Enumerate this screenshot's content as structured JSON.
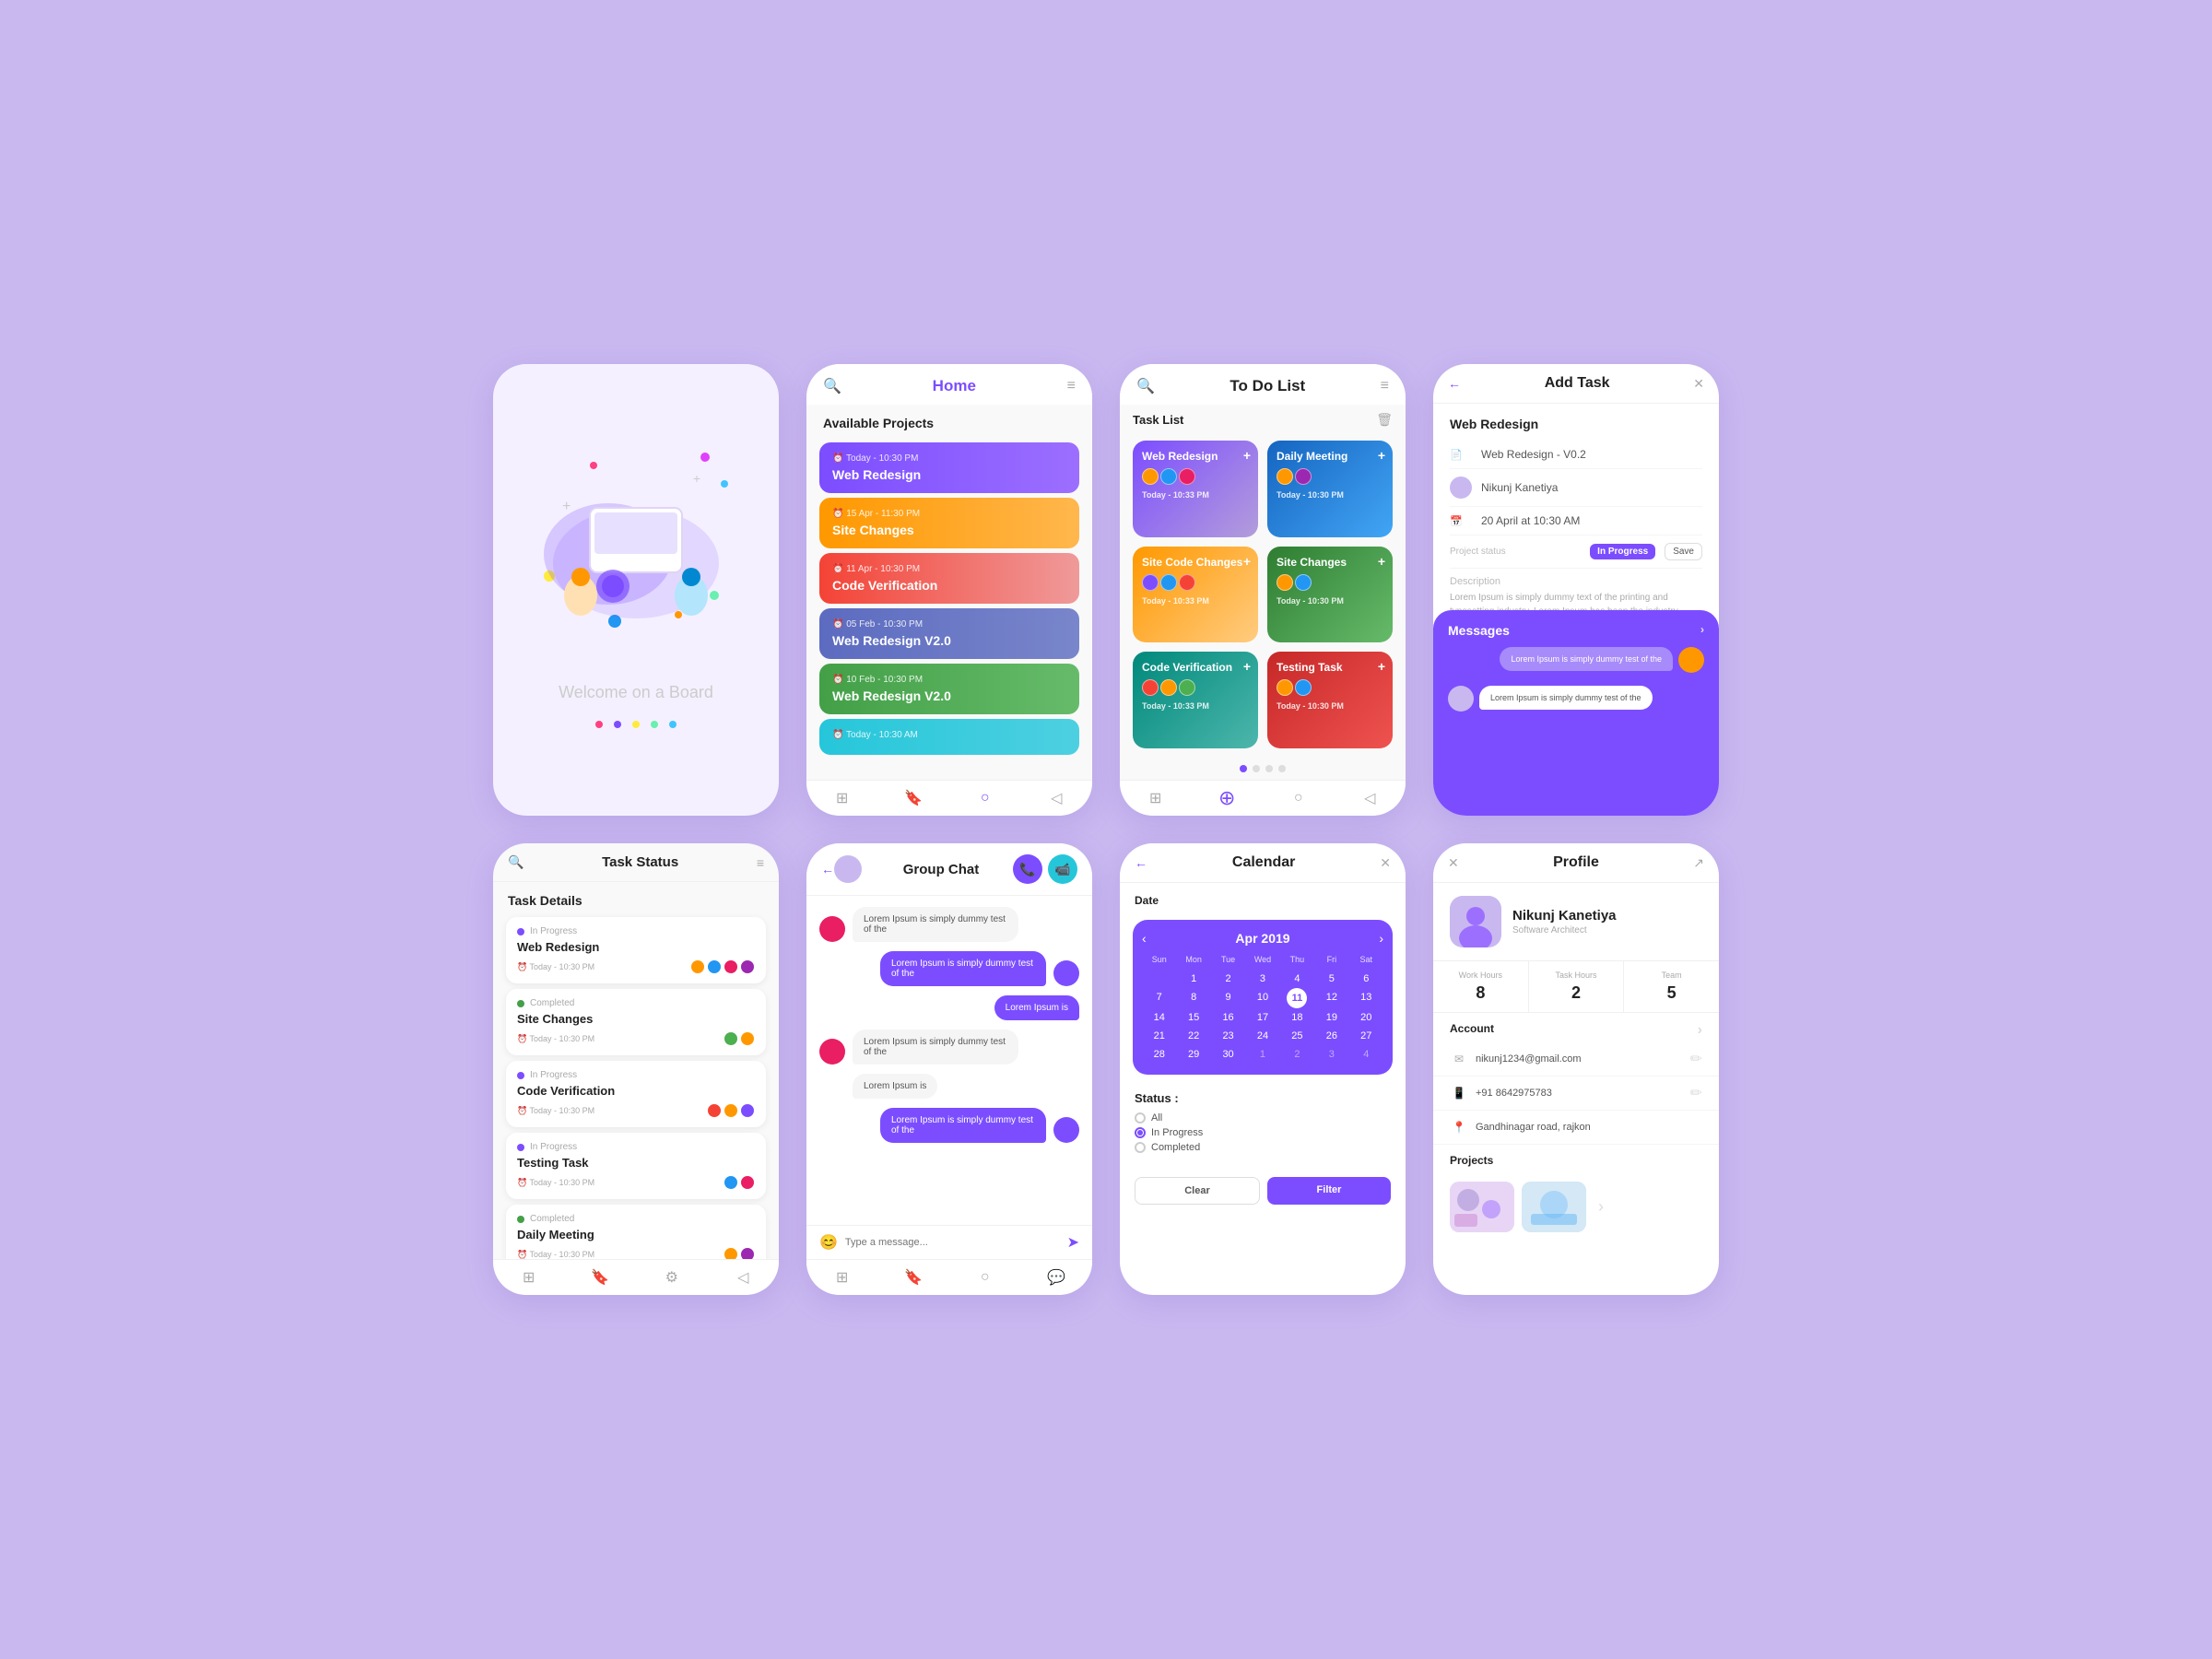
{
  "bg": "#c9b8f0",
  "screens": {
    "welcome": {
      "text": "Welcome on a Board"
    },
    "home": {
      "title": "Home",
      "section": "Available Projects",
      "projects": [
        {
          "time": "Today - 10:30 PM",
          "name": "Web Redesign",
          "color": "card-purple"
        },
        {
          "time": "15 Apr - 11:30 PM",
          "name": "Site Changes",
          "color": "card-orange"
        },
        {
          "time": "11 Apr - 10:30 PM",
          "name": "Code Verification",
          "color": "card-pink"
        },
        {
          "time": "05 Feb - 10:30 PM",
          "name": "Web Redesign V2.0",
          "color": "card-indigo"
        },
        {
          "time": "10 Feb - 10:30 PM",
          "name": "Web Redesign V2.0",
          "color": "card-green"
        },
        {
          "time": "Today - 10:30 AM",
          "name": "",
          "color": "card-teal"
        }
      ]
    },
    "todo": {
      "title": "To Do List",
      "section": "Task List",
      "tasks": [
        {
          "name": "Web Redesign",
          "color": "tc-purple",
          "time": "Today - 10:33 PM"
        },
        {
          "name": "Daily Meeting",
          "color": "tc-blue",
          "time": "Today - 10:30 PM"
        },
        {
          "name": "Site Code Changes",
          "color": "tc-orange",
          "time": "Today - 10:33 PM"
        },
        {
          "name": "Site Changes",
          "color": "tc-green",
          "time": "Today - 10:30 PM"
        },
        {
          "name": "Code Verification",
          "color": "tc-teal",
          "time": "Today - 10:33 PM"
        },
        {
          "name": "Testing Task",
          "color": "tc-red",
          "time": "Today - 10:30 PM"
        }
      ]
    },
    "addtask": {
      "title": "Add Task",
      "task_name": "Web Redesign",
      "version": "Web Redesign - V0.2",
      "assignee": "Nikunj Kanetiya",
      "date": "20 April at 10:30 AM",
      "project_status_label": "Project status",
      "status_value": "In Progress",
      "save_label": "Save",
      "description_label": "Description",
      "desc_text": "Lorem Ipsum is simply dummy text of the printing and typesetting industry. Lorem Ipsum has been the industry standard dummy text ever from the 1500s, when an unknown printer took a galley of type and",
      "messages_title": "Messages",
      "messages_arrow": ">",
      "msg1": "Lorem Ipsum is simply dummy test of the",
      "msg2": "Lorem Ipsum is simply dummy test of the"
    },
    "taskstatus": {
      "title": "Task Status",
      "section": "Task Details",
      "tasks": [
        {
          "status": "In Progress",
          "name": "Web Redesign",
          "time": "Today - 10:30 PM",
          "dot_color": "#7c4dff"
        },
        {
          "status": "Completed",
          "name": "Site Changes",
          "time": "Today - 10:30 PM",
          "dot_color": "#43a047"
        },
        {
          "status": "In Progress",
          "name": "Code Verification",
          "time": "Today - 10:30 PM",
          "dot_color": "#7c4dff"
        },
        {
          "status": "In Progress",
          "name": "Testing Task",
          "time": "Today - 10:30 PM",
          "dot_color": "#7c4dff"
        },
        {
          "status": "Completed",
          "name": "Daily Meeting",
          "time": "Today - 10:30 PM",
          "dot_color": "#43a047"
        }
      ]
    },
    "groupchat": {
      "title": "Group Chat",
      "messages": [
        {
          "side": "left",
          "text": "Lorem Ipsum is simply dummy test of the"
        },
        {
          "side": "right",
          "text": "Lorem Ipsum is simply dummy test of the"
        },
        {
          "side": "right",
          "text": "Lorem Ipsum is"
        },
        {
          "side": "left",
          "text": "Lorem Ipsum is simply dummy test of the"
        },
        {
          "side": "left",
          "text": "Lorem Ipsum is"
        },
        {
          "side": "right",
          "text": "Lorem Ipsum is simply dummy test of the"
        }
      ],
      "input_placeholder": "Type a message..."
    },
    "calendar": {
      "title": "Calendar",
      "date_label": "Date",
      "month": "Apr 2019",
      "days_of_week": [
        "Sun",
        "Mon",
        "Tue",
        "Wed",
        "Thu",
        "Fri",
        "Sat"
      ],
      "today": 11,
      "status_label": "Status :",
      "options": [
        "All",
        "In Progress",
        "Completed"
      ],
      "selected": "In Progress",
      "btn_clear": "Clear",
      "btn_filter": "Filter"
    },
    "profile": {
      "title": "Profile",
      "name": "Nikunj Kanetiya",
      "subtitle": "Software Architect",
      "stats": [
        {
          "label": "Work Hours",
          "value": "8"
        },
        {
          "label": "Task Hours",
          "value": "2"
        },
        {
          "label": "Team",
          "value": "5"
        }
      ],
      "account_label": "Account",
      "email": "nikunj1234@gmail.com",
      "phone": "+91 8642975783",
      "address": "Gandhinagar road, rajkon",
      "projects_label": "Projects"
    }
  }
}
